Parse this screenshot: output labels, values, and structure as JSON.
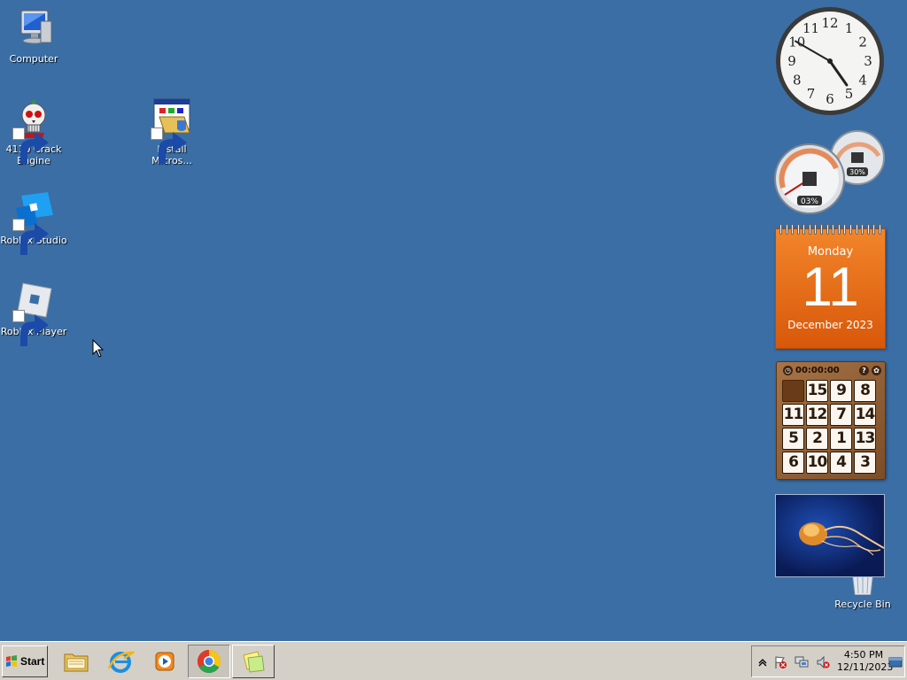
{
  "desktop": {
    "background_color": "#3b6ea5",
    "icons": [
      {
        "label": "Computer",
        "icon": "computer-icon",
        "shortcut": false
      },
      {
        "label": "4110 Crack Engine",
        "icon": "skull-icon",
        "shortcut": true
      },
      {
        "label": "Install Micros...",
        "icon": "installer-icon",
        "shortcut": true
      },
      {
        "label": "Roblox Studio",
        "icon": "roblox-studio-icon",
        "shortcut": true
      },
      {
        "label": "Roblox Player",
        "icon": "roblox-player-icon",
        "shortcut": true
      },
      {
        "label": "Recycle Bin",
        "icon": "recycle-bin-icon",
        "shortcut": false
      }
    ]
  },
  "gadgets": {
    "clock": {
      "time": "4:50",
      "numerals": [
        "12",
        "1",
        "2",
        "3",
        "4",
        "5",
        "6",
        "7",
        "8",
        "9",
        "10",
        "11"
      ]
    },
    "cpu_meter": {
      "cpu": "03%",
      "memory": "30%"
    },
    "calendar": {
      "day_name": "Monday",
      "day_number": "11",
      "month_year": "December 2023",
      "color": "#e56a15"
    },
    "puzzle": {
      "timer": "00:00:00",
      "tiles": [
        "",
        "15",
        "9",
        "8",
        "11",
        "12",
        "7",
        "14",
        "5",
        "2",
        "1",
        "13",
        "6",
        "10",
        "4",
        "3"
      ]
    },
    "slideshow": {
      "subject": "jellyfish"
    }
  },
  "taskbar": {
    "start_label": "Start",
    "apps": [
      {
        "name": "Windows Explorer",
        "icon": "folder-icon"
      },
      {
        "name": "Internet Explorer",
        "icon": "internet-explorer-icon"
      },
      {
        "name": "Windows Media Player",
        "icon": "media-player-icon"
      },
      {
        "name": "Google Chrome",
        "icon": "chrome-icon"
      },
      {
        "name": "Sticky Notes",
        "icon": "sticky-notes-icon"
      }
    ],
    "tray": {
      "time": "4:50 PM",
      "date": "12/11/2023",
      "icons": [
        "show-hidden-icons-chevron",
        "action-center-flag-icon",
        "network-icon",
        "volume-muted-icon"
      ]
    }
  }
}
